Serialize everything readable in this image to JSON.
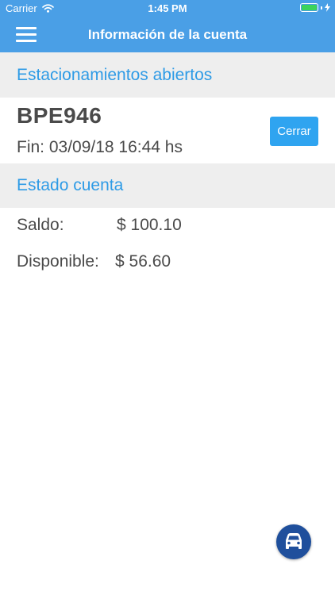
{
  "status_bar": {
    "carrier": "Carrier",
    "time": "1:45 PM",
    "battery_icon": "battery-full-icon",
    "wifi_icon": "wifi-icon",
    "charging_icon": "charging-bolt-icon"
  },
  "header": {
    "title": "Información de la cuenta",
    "menu_icon": "hamburger-menu-icon",
    "background_color": "#4a9fe6"
  },
  "open_parkings": {
    "section_title": "Estacionamientos abiertos",
    "items": [
      {
        "plate": "BPE946",
        "end_time": "Fin: 03/09/18 16:44 hs",
        "close_label": "Cerrar"
      }
    ]
  },
  "account_status": {
    "section_title": "Estado cuenta",
    "balance_label": "Saldo:",
    "balance_value": "$ 100.10",
    "available_label": "Disponible:",
    "available_value": "$ 56.60"
  },
  "fab": {
    "icon": "car-icon"
  },
  "colors": {
    "accent": "#2e9be6",
    "button": "#2fa4f0",
    "section_background": "#eeeeee",
    "fab": "#1f4f9c",
    "text": "#4a4a4a"
  }
}
